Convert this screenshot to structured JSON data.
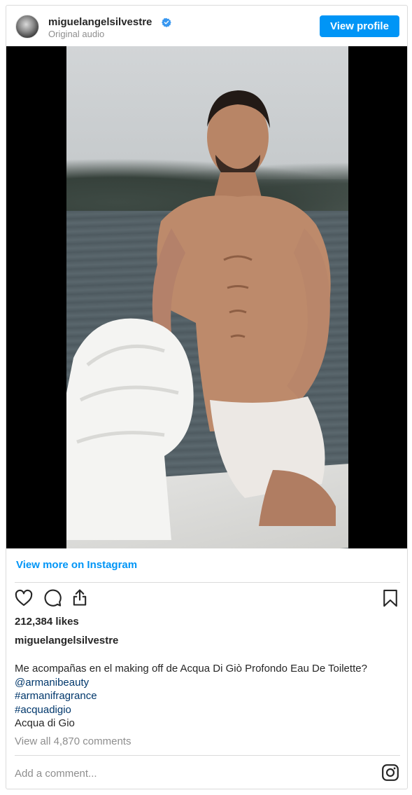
{
  "header": {
    "username": "miguelangelsilvestre",
    "subtitle": "Original audio",
    "view_profile_label": "View profile"
  },
  "media": {
    "description_icon": "video-post"
  },
  "links": {
    "view_more_label": "View more on Instagram"
  },
  "stats": {
    "likes": "212,384 likes"
  },
  "caption": {
    "author": "miguelangelsilvestre",
    "text": "Me acompañas en el making off de Acqua Di Giò Profondo Eau De Toilette?",
    "tags": [
      "@armanibeauty",
      "#armanifragrance",
      "#acquadigio"
    ],
    "footer": "Acqua di Gio"
  },
  "comments": {
    "view_all_label": "View all 4,870 comments",
    "input_placeholder": "Add a comment..."
  },
  "icons": {
    "like": "heart-icon",
    "comment": "comment-icon",
    "share": "share-icon",
    "save": "bookmark-icon",
    "brand": "instagram-icon",
    "verified": "verified-badge-icon"
  },
  "colors": {
    "accent": "#0095f6",
    "tag": "#00376b",
    "muted": "#8e8e8e",
    "text": "#262626",
    "border": "#dbdbdb"
  }
}
